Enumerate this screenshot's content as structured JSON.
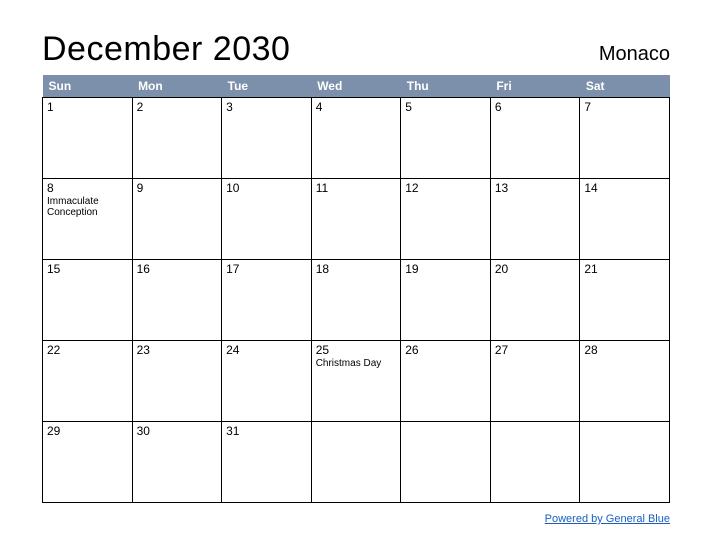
{
  "title": "December 2030",
  "country": "Monaco",
  "day_headers": [
    "Sun",
    "Mon",
    "Tue",
    "Wed",
    "Thu",
    "Fri",
    "Sat"
  ],
  "weeks": [
    [
      {
        "day": "1",
        "event": ""
      },
      {
        "day": "2",
        "event": ""
      },
      {
        "day": "3",
        "event": ""
      },
      {
        "day": "4",
        "event": ""
      },
      {
        "day": "5",
        "event": ""
      },
      {
        "day": "6",
        "event": ""
      },
      {
        "day": "7",
        "event": ""
      }
    ],
    [
      {
        "day": "8",
        "event": "Immaculate Conception"
      },
      {
        "day": "9",
        "event": ""
      },
      {
        "day": "10",
        "event": ""
      },
      {
        "day": "11",
        "event": ""
      },
      {
        "day": "12",
        "event": ""
      },
      {
        "day": "13",
        "event": ""
      },
      {
        "day": "14",
        "event": ""
      }
    ],
    [
      {
        "day": "15",
        "event": ""
      },
      {
        "day": "16",
        "event": ""
      },
      {
        "day": "17",
        "event": ""
      },
      {
        "day": "18",
        "event": ""
      },
      {
        "day": "19",
        "event": ""
      },
      {
        "day": "20",
        "event": ""
      },
      {
        "day": "21",
        "event": ""
      }
    ],
    [
      {
        "day": "22",
        "event": ""
      },
      {
        "day": "23",
        "event": ""
      },
      {
        "day": "24",
        "event": ""
      },
      {
        "day": "25",
        "event": "Christmas Day"
      },
      {
        "day": "26",
        "event": ""
      },
      {
        "day": "27",
        "event": ""
      },
      {
        "day": "28",
        "event": ""
      }
    ],
    [
      {
        "day": "29",
        "event": ""
      },
      {
        "day": "30",
        "event": ""
      },
      {
        "day": "31",
        "event": ""
      },
      {
        "day": "",
        "event": ""
      },
      {
        "day": "",
        "event": ""
      },
      {
        "day": "",
        "event": ""
      },
      {
        "day": "",
        "event": ""
      }
    ]
  ],
  "footer_link": "Powered by General Blue"
}
